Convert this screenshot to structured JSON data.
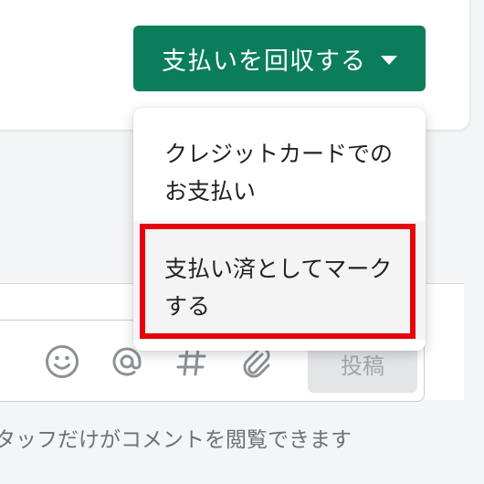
{
  "header": {
    "collect_button_label": "支払いを回収する"
  },
  "dropdown": {
    "items": [
      {
        "label": "クレジットカードでのお支払い"
      },
      {
        "label": "支払い済としてマークする"
      }
    ]
  },
  "composer": {
    "post_button_label": "投稿",
    "icons": [
      "emoji-icon",
      "mention-icon",
      "hashtag-icon",
      "attachment-icon"
    ]
  },
  "note": {
    "text": "タッフだけがコメントを閲覧できます"
  },
  "colors": {
    "primary_button": "#0b7d5b",
    "highlight_border": "#e5040b"
  }
}
